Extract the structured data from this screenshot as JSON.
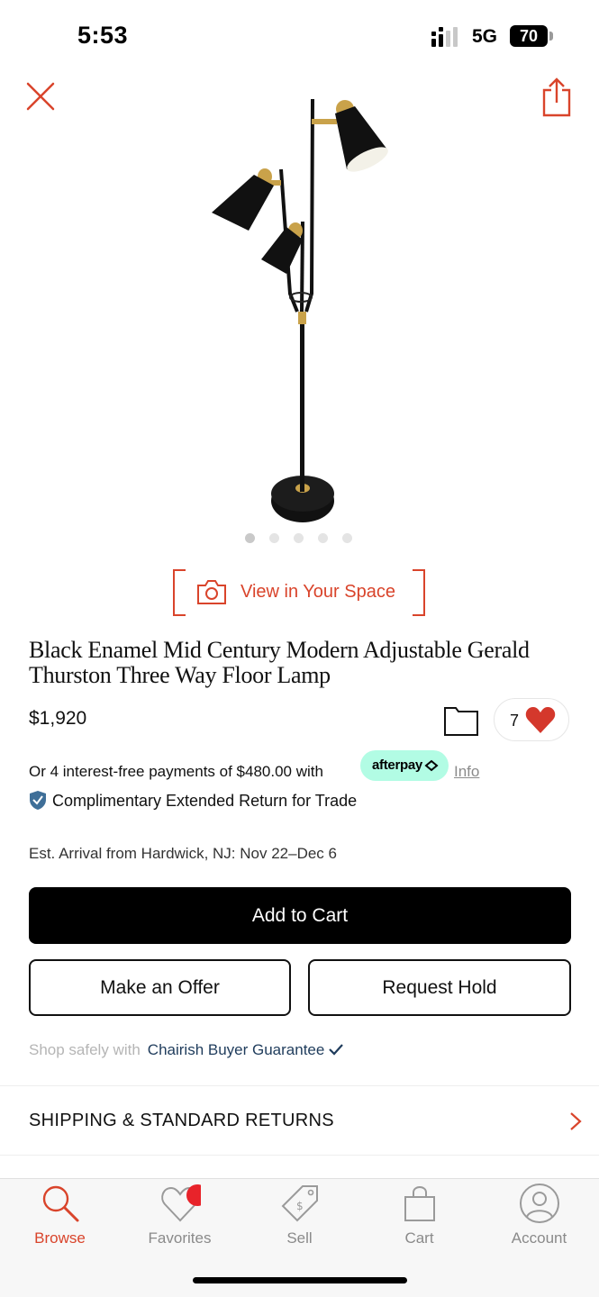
{
  "status_bar": {
    "time": "5:53",
    "network": "5G",
    "battery": "70"
  },
  "top_bar": {
    "close_icon": "close-icon",
    "share_icon": "share-icon",
    "accent_color": "#d9442b"
  },
  "gallery": {
    "image_count": 5,
    "active_index": 0
  },
  "view_in_space": {
    "label": "View in Your Space",
    "icon": "camera-icon"
  },
  "product": {
    "title": "Black Enamel Mid Century Modern Adjustable Gerald Thurston Three Way Floor Lamp",
    "price": "$1,920",
    "favorite_count": "7"
  },
  "payments": {
    "installments_text": "Or 4 interest-free payments of $480.00 with",
    "afterpay_label": "afterpay",
    "info_label": "Info",
    "afterpay_color": "#b2fce4"
  },
  "returns": {
    "text": "Complimentary Extended Return for Trade"
  },
  "arrival": {
    "text": "Est. Arrival from Hardwick, NJ: Nov 22–Dec 6"
  },
  "actions": {
    "add_to_cart": "Add to Cart",
    "make_offer": "Make an Offer",
    "request_hold": "Request Hold"
  },
  "guarantee": {
    "prefix": "Shop safely with",
    "link": "Chairish Buyer Guarantee"
  },
  "shipping": {
    "label": "SHIPPING & STANDARD RETURNS"
  },
  "tab_bar": {
    "tabs": [
      {
        "label": "Browse",
        "icon": "search-icon",
        "active": true
      },
      {
        "label": "Favorites",
        "icon": "heart-icon",
        "active": false
      },
      {
        "label": "Sell",
        "icon": "tag-icon",
        "active": false
      },
      {
        "label": "Cart",
        "icon": "bag-icon",
        "active": false
      },
      {
        "label": "Account",
        "icon": "user-icon",
        "active": false
      }
    ]
  }
}
